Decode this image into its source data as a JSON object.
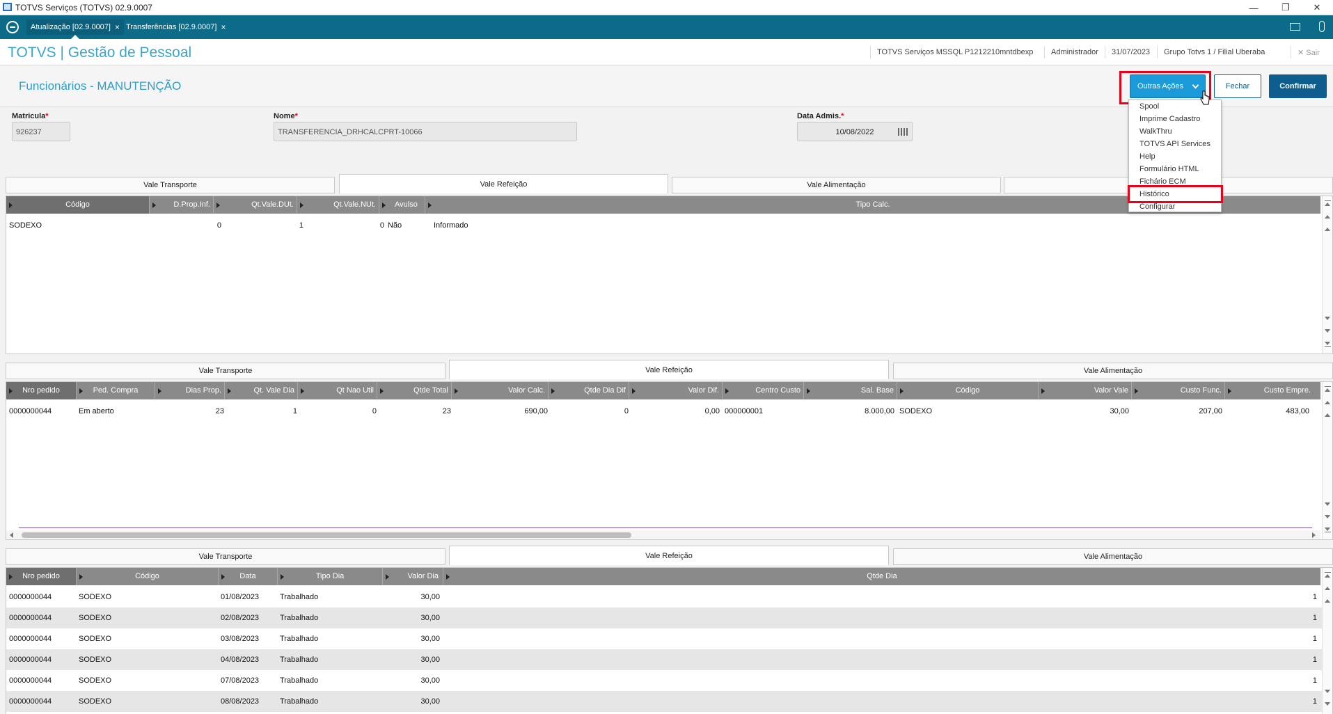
{
  "window": {
    "title": "TOTVS Serviços (TOTVS) 02.9.0007",
    "min": "—",
    "max": "❐",
    "close": "✕"
  },
  "app_tabs": [
    {
      "label": "Atualização [02.9.0007]",
      "close": "×"
    },
    {
      "label": "Transferências [02.9.0007]",
      "close": "×"
    }
  ],
  "header": {
    "brand": "TOTVS | Gestão de Pessoal",
    "server": "TOTVS Serviços MSSQL P1212210mntdbexp",
    "user": "Administrador",
    "date": "31/07/2023",
    "group": "Grupo Totvs 1 / Filial Uberaba",
    "exit": "Sair"
  },
  "form": {
    "title": "Funcionários - MANUTENÇÃO",
    "buttons": {
      "outras": "Outras Ações",
      "fechar": "Fechar",
      "confirmar": "Confirmar"
    },
    "fields": {
      "matricula": {
        "label": "Matricula",
        "req": "*",
        "value": "926237"
      },
      "nome": {
        "label": "Nome",
        "req": "*",
        "value": "TRANSFERENCIA_DRHCALCPRT-10066"
      },
      "data_admis": {
        "label": "Data Admis.",
        "req": "*",
        "value": "10/08/2022"
      }
    }
  },
  "menu": {
    "items": [
      "Spool",
      "Imprime Cadastro",
      "WalkThru",
      "TOTVS API Services",
      "Help",
      "Formulário HTML",
      "Fichário ECM",
      "Histórico",
      "Configurar"
    ]
  },
  "tabs": {
    "vt": "Vale Transporte",
    "vr": "Vale Refeição",
    "va": "Vale Alimentação"
  },
  "grid1": {
    "headers": [
      "Código",
      "D.Prop.Inf.",
      "Qt.Vale.DUt.",
      "Qt.Vale.NUt.",
      "Avulso",
      "Tipo Calc."
    ],
    "rows": [
      [
        "SODEXO",
        "0",
        "1",
        "0",
        "Não",
        "Informado"
      ]
    ]
  },
  "grid2": {
    "headers": [
      "Nro pedido",
      "Ped. Compra",
      "Dias Prop.",
      "Qt. Vale Dia",
      "Qt Nao Util",
      "Qtde Total",
      "Valor Calc.",
      "Qtde Dia Dif",
      "Valor Dif.",
      "Centro Custo",
      "Sal. Base",
      "Código",
      "Valor Vale",
      "Custo Func.",
      "Custo Empre."
    ],
    "rows": [
      [
        "0000000044",
        "Em aberto",
        "23",
        "1",
        "0",
        "23",
        "690,00",
        "0",
        "0,00",
        "000000001",
        "8.000,00",
        "SODEXO",
        "30,00",
        "207,00",
        "483,00"
      ]
    ]
  },
  "grid3": {
    "headers": [
      "Nro pedido",
      "Código",
      "Data",
      "Tipo Dia",
      "Valor Dia",
      "Qtde Dia"
    ],
    "rows": [
      [
        "0000000044",
        "SODEXO",
        "01/08/2023",
        "Trabalhado",
        "30,00",
        "1"
      ],
      [
        "0000000044",
        "SODEXO",
        "02/08/2023",
        "Trabalhado",
        "30,00",
        "1"
      ],
      [
        "0000000044",
        "SODEXO",
        "03/08/2023",
        "Trabalhado",
        "30,00",
        "1"
      ],
      [
        "0000000044",
        "SODEXO",
        "04/08/2023",
        "Trabalhado",
        "30,00",
        "1"
      ],
      [
        "0000000044",
        "SODEXO",
        "07/08/2023",
        "Trabalhado",
        "30,00",
        "1"
      ],
      [
        "0000000044",
        "SODEXO",
        "08/08/2023",
        "Trabalhado",
        "30,00",
        "1"
      ]
    ]
  },
  "colors": {
    "accent": "#1a9ad9",
    "primary": "#0d5d8f",
    "highlight": "#e8001c",
    "tabbar": "#0d6b8a"
  }
}
